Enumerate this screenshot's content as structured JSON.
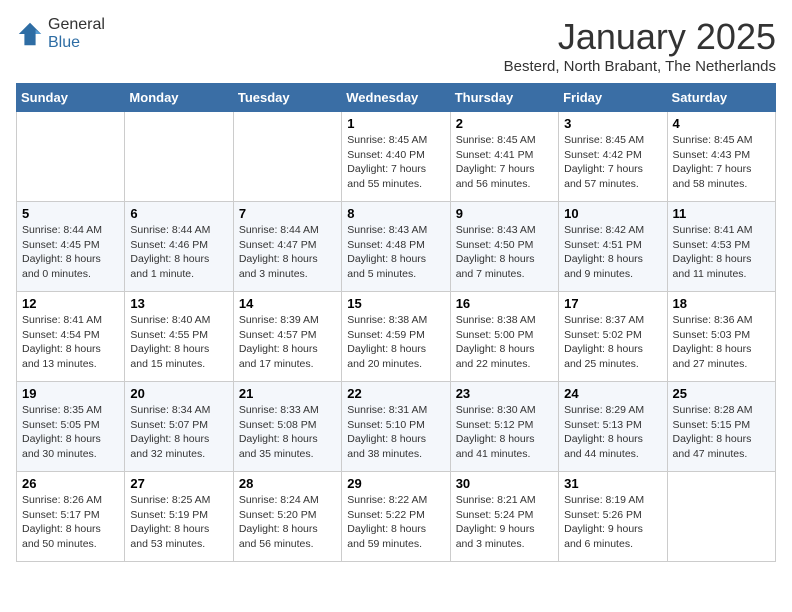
{
  "header": {
    "logo_line1": "General",
    "logo_line2": "Blue",
    "month": "January 2025",
    "location": "Besterd, North Brabant, The Netherlands"
  },
  "weekdays": [
    "Sunday",
    "Monday",
    "Tuesday",
    "Wednesday",
    "Thursday",
    "Friday",
    "Saturday"
  ],
  "weeks": [
    [
      {
        "day": "",
        "text": ""
      },
      {
        "day": "",
        "text": ""
      },
      {
        "day": "",
        "text": ""
      },
      {
        "day": "1",
        "text": "Sunrise: 8:45 AM\nSunset: 4:40 PM\nDaylight: 7 hours\nand 55 minutes."
      },
      {
        "day": "2",
        "text": "Sunrise: 8:45 AM\nSunset: 4:41 PM\nDaylight: 7 hours\nand 56 minutes."
      },
      {
        "day": "3",
        "text": "Sunrise: 8:45 AM\nSunset: 4:42 PM\nDaylight: 7 hours\nand 57 minutes."
      },
      {
        "day": "4",
        "text": "Sunrise: 8:45 AM\nSunset: 4:43 PM\nDaylight: 7 hours\nand 58 minutes."
      }
    ],
    [
      {
        "day": "5",
        "text": "Sunrise: 8:44 AM\nSunset: 4:45 PM\nDaylight: 8 hours\nand 0 minutes."
      },
      {
        "day": "6",
        "text": "Sunrise: 8:44 AM\nSunset: 4:46 PM\nDaylight: 8 hours\nand 1 minute."
      },
      {
        "day": "7",
        "text": "Sunrise: 8:44 AM\nSunset: 4:47 PM\nDaylight: 8 hours\nand 3 minutes."
      },
      {
        "day": "8",
        "text": "Sunrise: 8:43 AM\nSunset: 4:48 PM\nDaylight: 8 hours\nand 5 minutes."
      },
      {
        "day": "9",
        "text": "Sunrise: 8:43 AM\nSunset: 4:50 PM\nDaylight: 8 hours\nand 7 minutes."
      },
      {
        "day": "10",
        "text": "Sunrise: 8:42 AM\nSunset: 4:51 PM\nDaylight: 8 hours\nand 9 minutes."
      },
      {
        "day": "11",
        "text": "Sunrise: 8:41 AM\nSunset: 4:53 PM\nDaylight: 8 hours\nand 11 minutes."
      }
    ],
    [
      {
        "day": "12",
        "text": "Sunrise: 8:41 AM\nSunset: 4:54 PM\nDaylight: 8 hours\nand 13 minutes."
      },
      {
        "day": "13",
        "text": "Sunrise: 8:40 AM\nSunset: 4:55 PM\nDaylight: 8 hours\nand 15 minutes."
      },
      {
        "day": "14",
        "text": "Sunrise: 8:39 AM\nSunset: 4:57 PM\nDaylight: 8 hours\nand 17 minutes."
      },
      {
        "day": "15",
        "text": "Sunrise: 8:38 AM\nSunset: 4:59 PM\nDaylight: 8 hours\nand 20 minutes."
      },
      {
        "day": "16",
        "text": "Sunrise: 8:38 AM\nSunset: 5:00 PM\nDaylight: 8 hours\nand 22 minutes."
      },
      {
        "day": "17",
        "text": "Sunrise: 8:37 AM\nSunset: 5:02 PM\nDaylight: 8 hours\nand 25 minutes."
      },
      {
        "day": "18",
        "text": "Sunrise: 8:36 AM\nSunset: 5:03 PM\nDaylight: 8 hours\nand 27 minutes."
      }
    ],
    [
      {
        "day": "19",
        "text": "Sunrise: 8:35 AM\nSunset: 5:05 PM\nDaylight: 8 hours\nand 30 minutes."
      },
      {
        "day": "20",
        "text": "Sunrise: 8:34 AM\nSunset: 5:07 PM\nDaylight: 8 hours\nand 32 minutes."
      },
      {
        "day": "21",
        "text": "Sunrise: 8:33 AM\nSunset: 5:08 PM\nDaylight: 8 hours\nand 35 minutes."
      },
      {
        "day": "22",
        "text": "Sunrise: 8:31 AM\nSunset: 5:10 PM\nDaylight: 8 hours\nand 38 minutes."
      },
      {
        "day": "23",
        "text": "Sunrise: 8:30 AM\nSunset: 5:12 PM\nDaylight: 8 hours\nand 41 minutes."
      },
      {
        "day": "24",
        "text": "Sunrise: 8:29 AM\nSunset: 5:13 PM\nDaylight: 8 hours\nand 44 minutes."
      },
      {
        "day": "25",
        "text": "Sunrise: 8:28 AM\nSunset: 5:15 PM\nDaylight: 8 hours\nand 47 minutes."
      }
    ],
    [
      {
        "day": "26",
        "text": "Sunrise: 8:26 AM\nSunset: 5:17 PM\nDaylight: 8 hours\nand 50 minutes."
      },
      {
        "day": "27",
        "text": "Sunrise: 8:25 AM\nSunset: 5:19 PM\nDaylight: 8 hours\nand 53 minutes."
      },
      {
        "day": "28",
        "text": "Sunrise: 8:24 AM\nSunset: 5:20 PM\nDaylight: 8 hours\nand 56 minutes."
      },
      {
        "day": "29",
        "text": "Sunrise: 8:22 AM\nSunset: 5:22 PM\nDaylight: 8 hours\nand 59 minutes."
      },
      {
        "day": "30",
        "text": "Sunrise: 8:21 AM\nSunset: 5:24 PM\nDaylight: 9 hours\nand 3 minutes."
      },
      {
        "day": "31",
        "text": "Sunrise: 8:19 AM\nSunset: 5:26 PM\nDaylight: 9 hours\nand 6 minutes."
      },
      {
        "day": "",
        "text": ""
      }
    ]
  ]
}
